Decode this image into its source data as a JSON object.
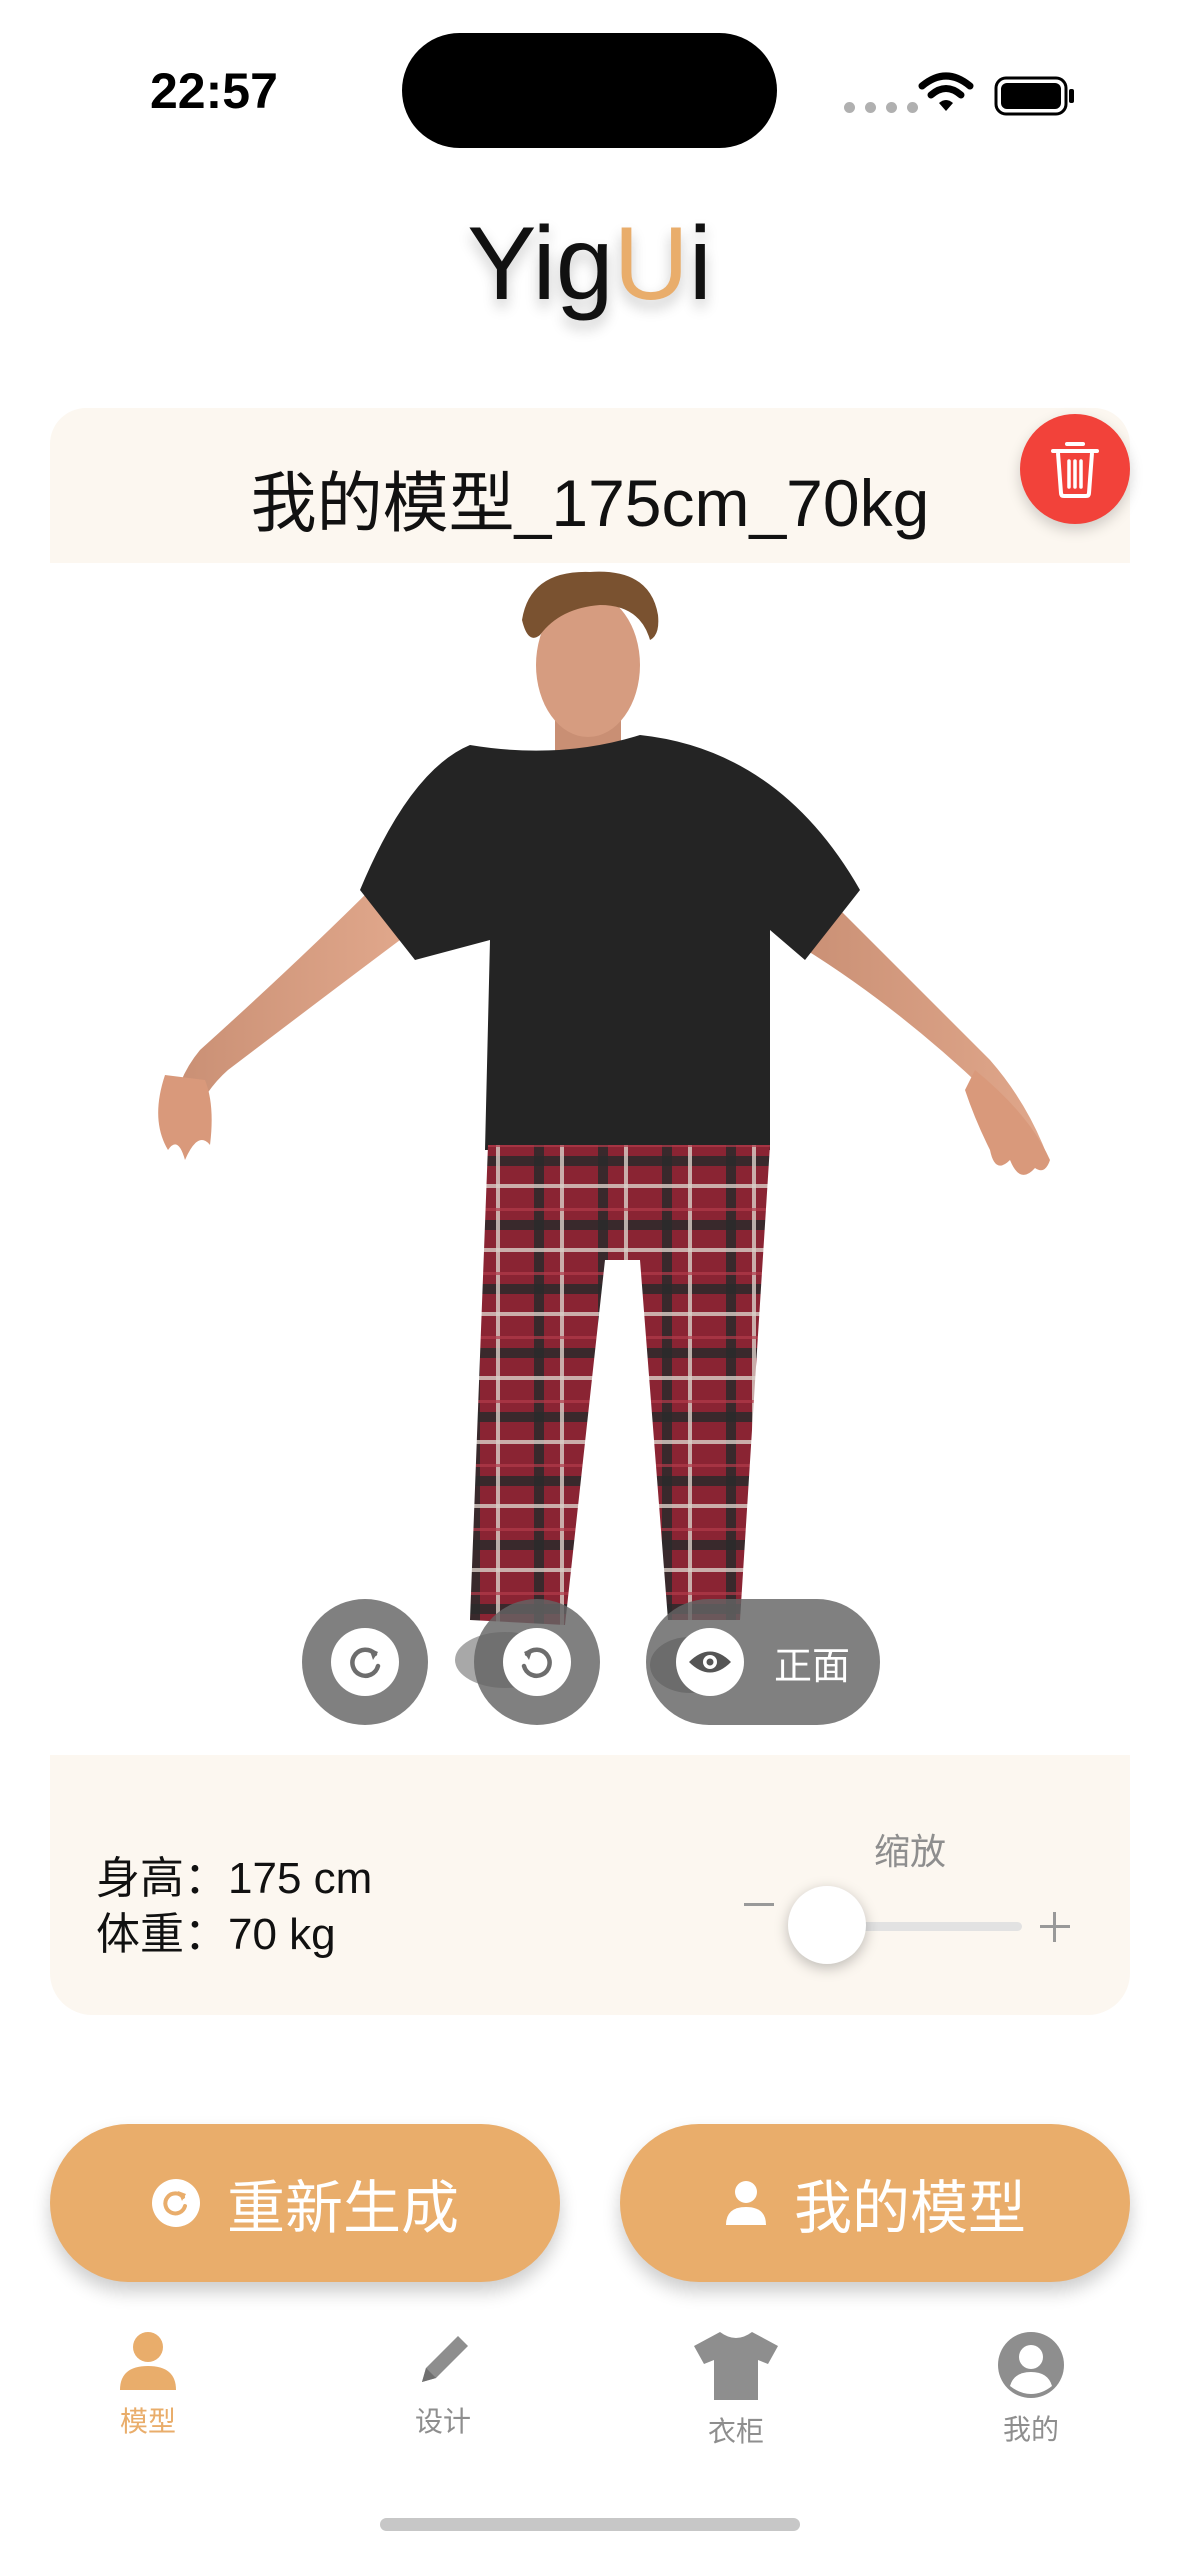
{
  "status_bar": {
    "time": "22:57"
  },
  "header": {
    "title_prefix": "Yig",
    "title_accent": "U",
    "title_suffix": "i"
  },
  "model": {
    "name": "我的模型_175cm_70kg"
  },
  "viewer": {
    "view_label": "正面"
  },
  "stats": {
    "height_label": "身高：",
    "height_value": "175 cm",
    "weight_label": "体重：",
    "weight_value": "70 kg"
  },
  "zoom": {
    "label": "缩放",
    "level": 0.1
  },
  "actions": {
    "regenerate_label": "重新生成",
    "my_model_label": "我的模型"
  },
  "tabbar": {
    "items": [
      {
        "label": "模型",
        "icon": "person-icon",
        "active": true
      },
      {
        "label": "设计",
        "icon": "pencil-icon",
        "active": false
      },
      {
        "label": "衣柜",
        "icon": "tshirt-icon",
        "active": false
      },
      {
        "label": "我的",
        "icon": "profile-icon",
        "active": false
      }
    ]
  },
  "colors": {
    "accent": "#e9ad6b",
    "delete": "#f2423a",
    "panel": "#fcf7f0",
    "tab_inactive": "#8e8e8e"
  }
}
